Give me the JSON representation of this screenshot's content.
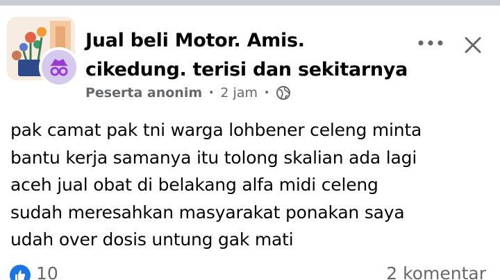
{
  "post": {
    "group_name_line1": "Jual beli Motor. Amis.",
    "group_name_line2": "cikedung. terisi dan sekitarnya",
    "author_role": "Peserta anonim",
    "separator": "•",
    "time": "2 jam",
    "privacy_icon": "globe-icon",
    "body_lines": [
      "pak camat pak tni warga lohbener celeng minta",
      "bantu kerja samanya itu tolong skalian ada lagi",
      "aceh jual obat di belakang alfa midi celeng",
      "sudah meresahkan masyarakat ponakan saya",
      "udah over dosis untung gak mati"
    ]
  },
  "actions": {
    "more_icon": "more-icon",
    "close_icon": "close-icon"
  },
  "reactions": {
    "like_icon": "like-icon",
    "like_count": "10",
    "comments": "2 komentar"
  },
  "colors": {
    "like_blue": "#1b74e4",
    "meta_gray": "#65676b",
    "anon_badge": "#d6c9ee",
    "anon_badge_icon": "#9b3ad6"
  }
}
